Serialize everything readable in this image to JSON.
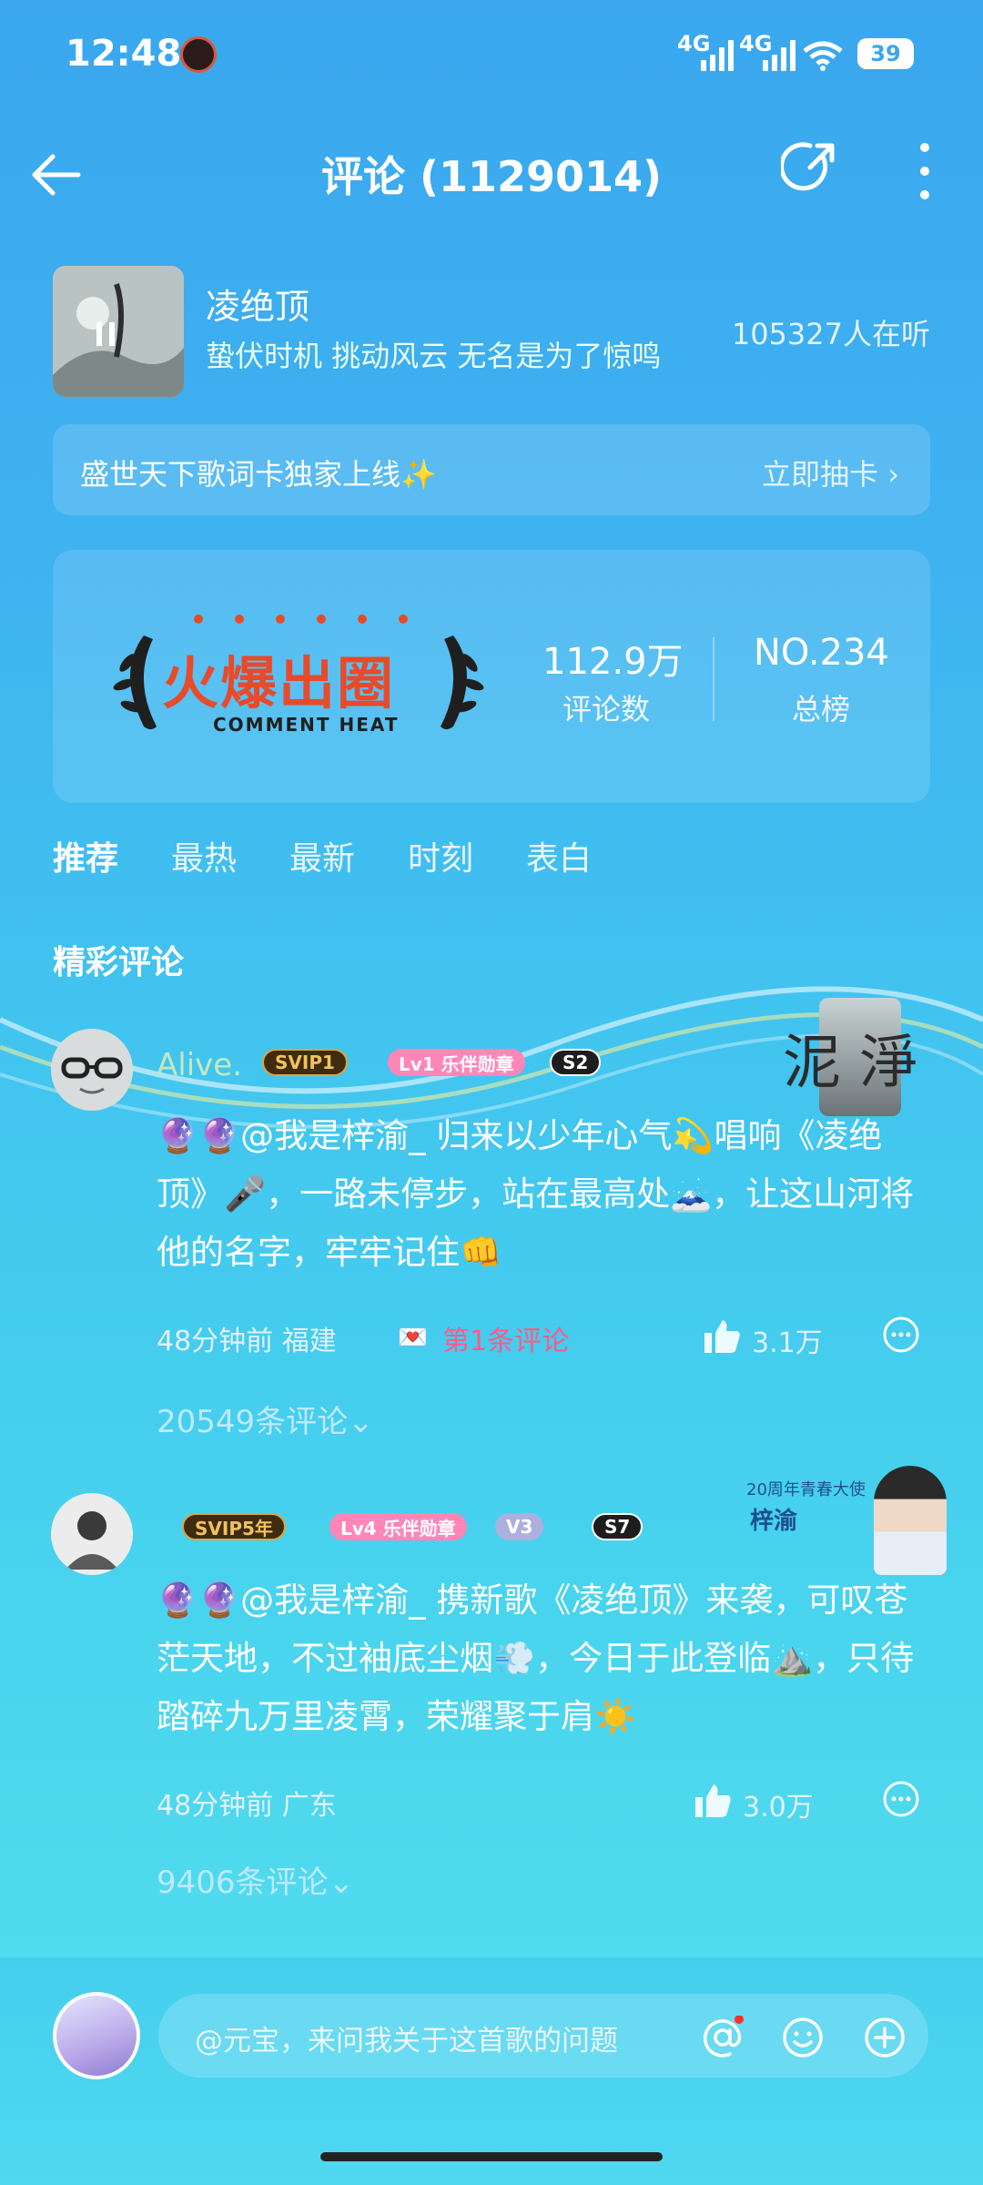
{
  "status_bar": {
    "time": "12:48",
    "network1": "4G",
    "network2": "4G",
    "battery": "39"
  },
  "header": {
    "title": "评论 (1129014)"
  },
  "song": {
    "name": "凌绝顶",
    "lyric": "蛰伏时机 挑动风云 无名是为了惊鸣",
    "listeners": "105327人在听"
  },
  "promo": {
    "text": "盛世天下歌词卡独家上线✨",
    "link": "立即抽卡 ›"
  },
  "heat": {
    "logo_title": "火爆出圈",
    "logo_sub": "COMMENT HEAT",
    "comment_count": "112.9万",
    "comment_label": "评论数",
    "rank": "NO.234",
    "rank_label": "总榜"
  },
  "tabs": [
    "推荐",
    "最热",
    "最新",
    "时刻",
    "表白"
  ],
  "section_title": "精彩评论",
  "comments": [
    {
      "username": "Alive.",
      "svip": "SVIP1",
      "level": "Lv1 乐伴勋章",
      "season": "S2",
      "text": "🔮🔮@我是梓渝_ 归来以少年心气💫唱响《凌绝顶》🎤，一路未停步，站在最高处🗻，让这山河将他的名字，牢牢记住👊",
      "time_loc": "48分钟前 福建",
      "tag": "第1条评论",
      "likes": "3.1万",
      "replies": "20549条评论⌄",
      "deco_text": "泥 淨"
    },
    {
      "username": "",
      "svip": "SVIP5年",
      "level": "Lv4 乐伴勋章",
      "vip_level": "V3",
      "season": "S7",
      "text": "🔮🔮@我是梓渝_ 携新歌《凌绝顶》来袭，可叹苍茫天地，不过袖底尘烟💨，今日于此登临⛰️，只待踏碎九万里凌霄，荣耀聚于肩☀️",
      "time_loc": "48分钟前 广东",
      "likes": "3.0万",
      "replies": "9406条评论⌄",
      "deco_top": "20周年青春大使",
      "deco_name": "梓渝"
    }
  ],
  "bottom_bar": {
    "placeholder": "@元宝，来问我关于这首歌的问题"
  },
  "colors": {
    "accent_pink": "#ff5a87",
    "svip_gold": "#e0a53a"
  }
}
